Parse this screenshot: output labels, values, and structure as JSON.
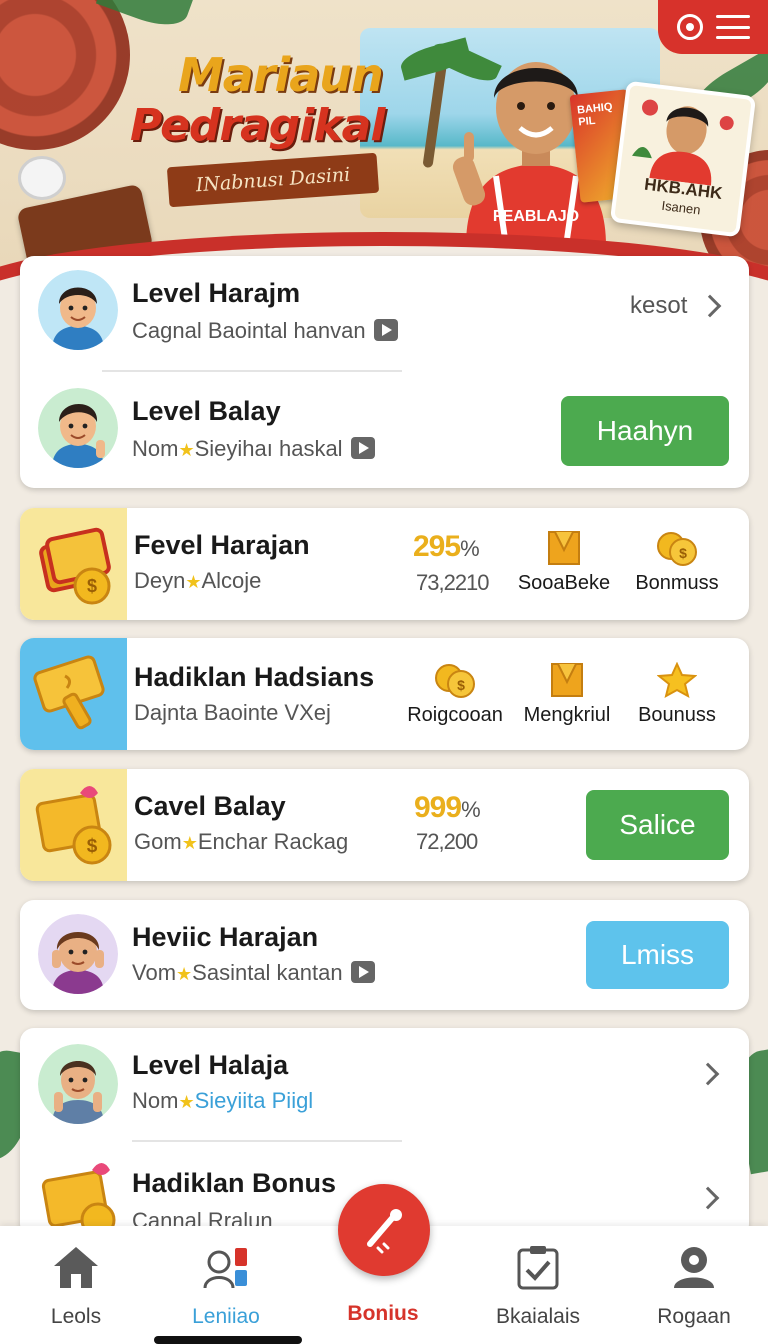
{
  "hero": {
    "title_line1": "Mariaun",
    "title_line2": "Pedragikal",
    "ribbon": "INabnusı Dasini",
    "book_label": "BAHIQ PIL",
    "card_title": "HKB.AHK",
    "card_sub": "Isanen",
    "shirt_text": "FEABLAJO"
  },
  "top_controls": {
    "record_icon": "record-icon",
    "menu_icon": "menu-icon"
  },
  "card1": {
    "row1": {
      "title": "Level Harajm",
      "subtitle": "Cagnal Baointal hanvan",
      "link": "kesot"
    },
    "row2": {
      "title": "Level Balay",
      "subtitle_prefix": "Nom",
      "subtitle_rest": "Sieyihaı haskal",
      "button": "Haahyn"
    }
  },
  "card2": {
    "title": "Fevel Harajan",
    "subtitle_prefix": "Deyn",
    "subtitle_rest": "Alcoje",
    "pct_value": "295",
    "pct_sign": "%",
    "stat_sub": "73,2210",
    "mini1": "SooaBeke",
    "mini2": "Bonmuss"
  },
  "card3": {
    "title": "Hadiklan Hadsians",
    "subtitle": "Dajnta Baointe VXej",
    "mini1": "Roigcooan",
    "mini2": "Mengkriul",
    "mini3": "Bounuss"
  },
  "card4": {
    "title": "Cavel Balay",
    "subtitle_prefix": "Gom",
    "subtitle_rest": "Enchar Rackag",
    "pct_value": "999",
    "pct_sign": "%",
    "stat_sub": "72,200",
    "button": "Salice"
  },
  "card5": {
    "title": "Heviic Harajan",
    "subtitle_prefix": "Vom",
    "subtitle_rest": "Sasintal kantan",
    "button": "Lmiss"
  },
  "card6": {
    "row1": {
      "title": "Level Halaja",
      "subtitle_prefix": "Nom",
      "subtitle_rest": "Sieyiita Piigl"
    },
    "row2": {
      "title": "Hadiklan Bonus",
      "subtitle": "Cannal Rralun"
    }
  },
  "bottom_nav": {
    "items": [
      {
        "label": "Leols",
        "icon": "home-icon"
      },
      {
        "label": "Leniiao",
        "icon": "id-badge-icon"
      },
      {
        "label": "Bonius",
        "icon": "gift-icon"
      },
      {
        "label": "Bkaialais",
        "icon": "clipboard-check-icon"
      },
      {
        "label": "Rogaan",
        "icon": "user-icon"
      }
    ],
    "fab_icon": "microphone-icon"
  },
  "colors": {
    "brand_red": "#d7322b",
    "green": "#4caa4f",
    "sky": "#5ec3ec",
    "gold": "#eaaf1c"
  }
}
